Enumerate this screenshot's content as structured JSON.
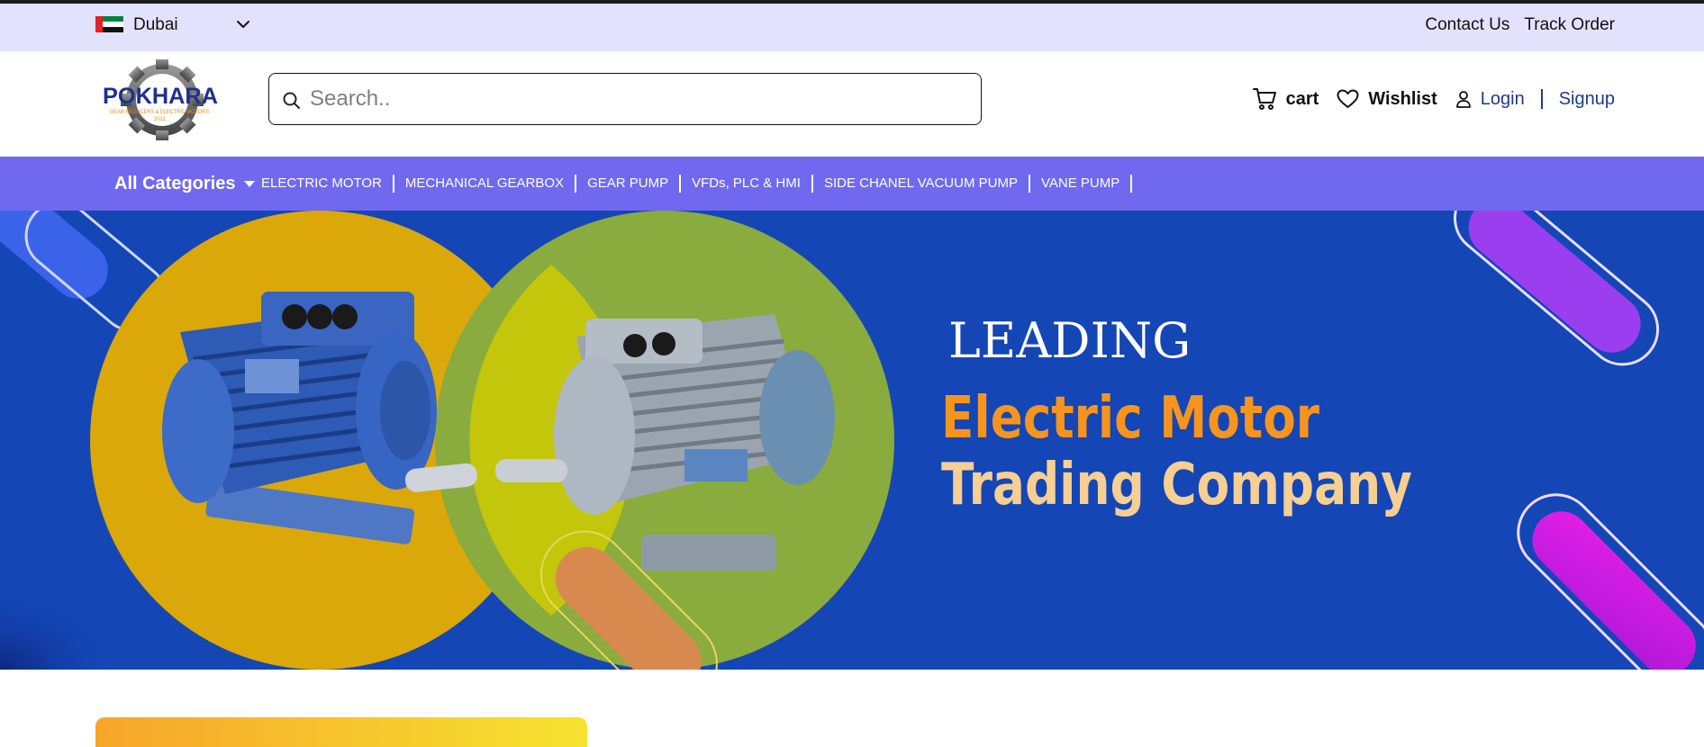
{
  "topbar": {
    "country": "Dubai",
    "flag_icon": "uae-flag-icon",
    "links": [
      "Contact Us",
      "Track Order"
    ]
  },
  "header": {
    "logo": {
      "brand": "POKHARA",
      "tagline": "GEAR REDUCERS & ELECTRIC MOTORS",
      "year": "2011"
    },
    "search": {
      "placeholder": "Search.."
    },
    "cart_label": "cart",
    "wishlist_label": "Wishlist",
    "login_label": "Login",
    "signup_label": "Signup"
  },
  "catnav": {
    "all_categories": "All Categories",
    "items": [
      "ELECTRIC MOTOR",
      "MECHANICAL GEARBOX",
      "GEAR PUMP",
      "VFDs, PLC & HMI",
      "SIDE CHANEL VACUUM PUMP",
      "VANE PUMP"
    ]
  },
  "banner": {
    "line1": "LEADING",
    "line2": "Electric Motor",
    "line3": "Trading Company"
  },
  "colors": {
    "topbar_bg": "#e3e2fc",
    "nav_bg": "#7069ef",
    "banner_bg": "#1446b6",
    "accent_blue": "#1d3b8a",
    "orange": "#f7941d",
    "cream": "#f6cf92"
  }
}
